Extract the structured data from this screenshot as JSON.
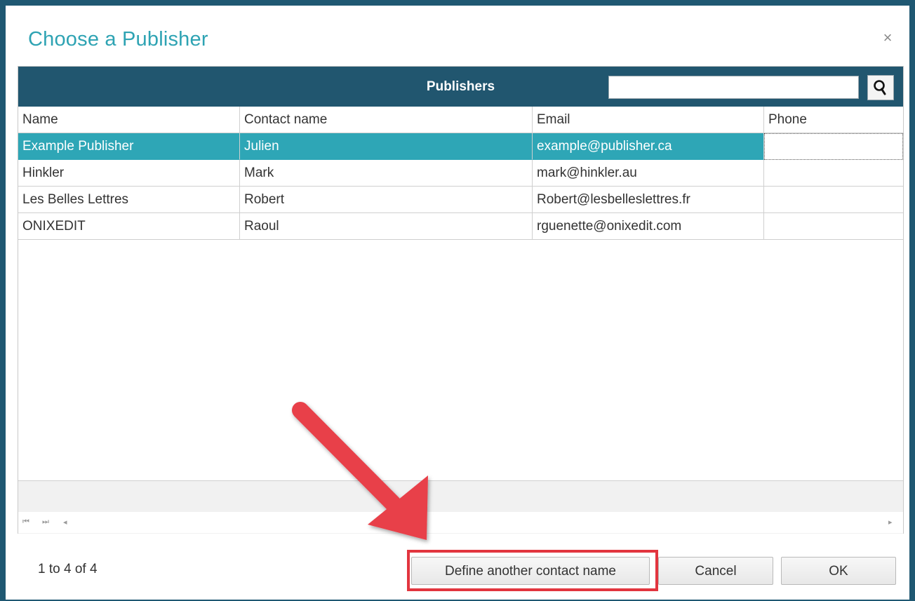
{
  "dialog": {
    "title": "Choose a Publisher",
    "close_label": "×"
  },
  "grid": {
    "title": "Publishers",
    "search": {
      "value": "",
      "placeholder": ""
    },
    "columns": [
      "Name",
      "Contact name",
      "Email",
      "Phone"
    ],
    "rows": [
      {
        "name": "Example Publisher",
        "contact": "Julien",
        "email": "example@publisher.ca",
        "phone": "",
        "selected": true
      },
      {
        "name": "Hinkler",
        "contact": "Mark",
        "email": "mark@hinkler.au",
        "phone": ""
      },
      {
        "name": "Les Belles Lettres",
        "contact": "Robert",
        "email": "Robert@lesbelleslettres.fr",
        "phone": ""
      },
      {
        "name": "ONIXEDIT",
        "contact": "Raoul",
        "email": "rguenette@onixedit.com",
        "phone": ""
      }
    ],
    "pager": {
      "first_icon": "⏮",
      "last_icon": "⏭",
      "left_icon": "◂",
      "right_icon": "▸"
    }
  },
  "footer": {
    "status": "1 to 4 of 4",
    "define_contact_label": "Define another contact name",
    "cancel_label": "Cancel",
    "ok_label": "OK"
  },
  "colors": {
    "header_bg": "#21566f",
    "selected_row": "#2ea6b6",
    "title_color": "#2ea3b3",
    "annotation_red": "#e2353f"
  },
  "icons": {
    "search": "search-icon",
    "close": "close-icon",
    "annotation": "arrow-annotation"
  }
}
